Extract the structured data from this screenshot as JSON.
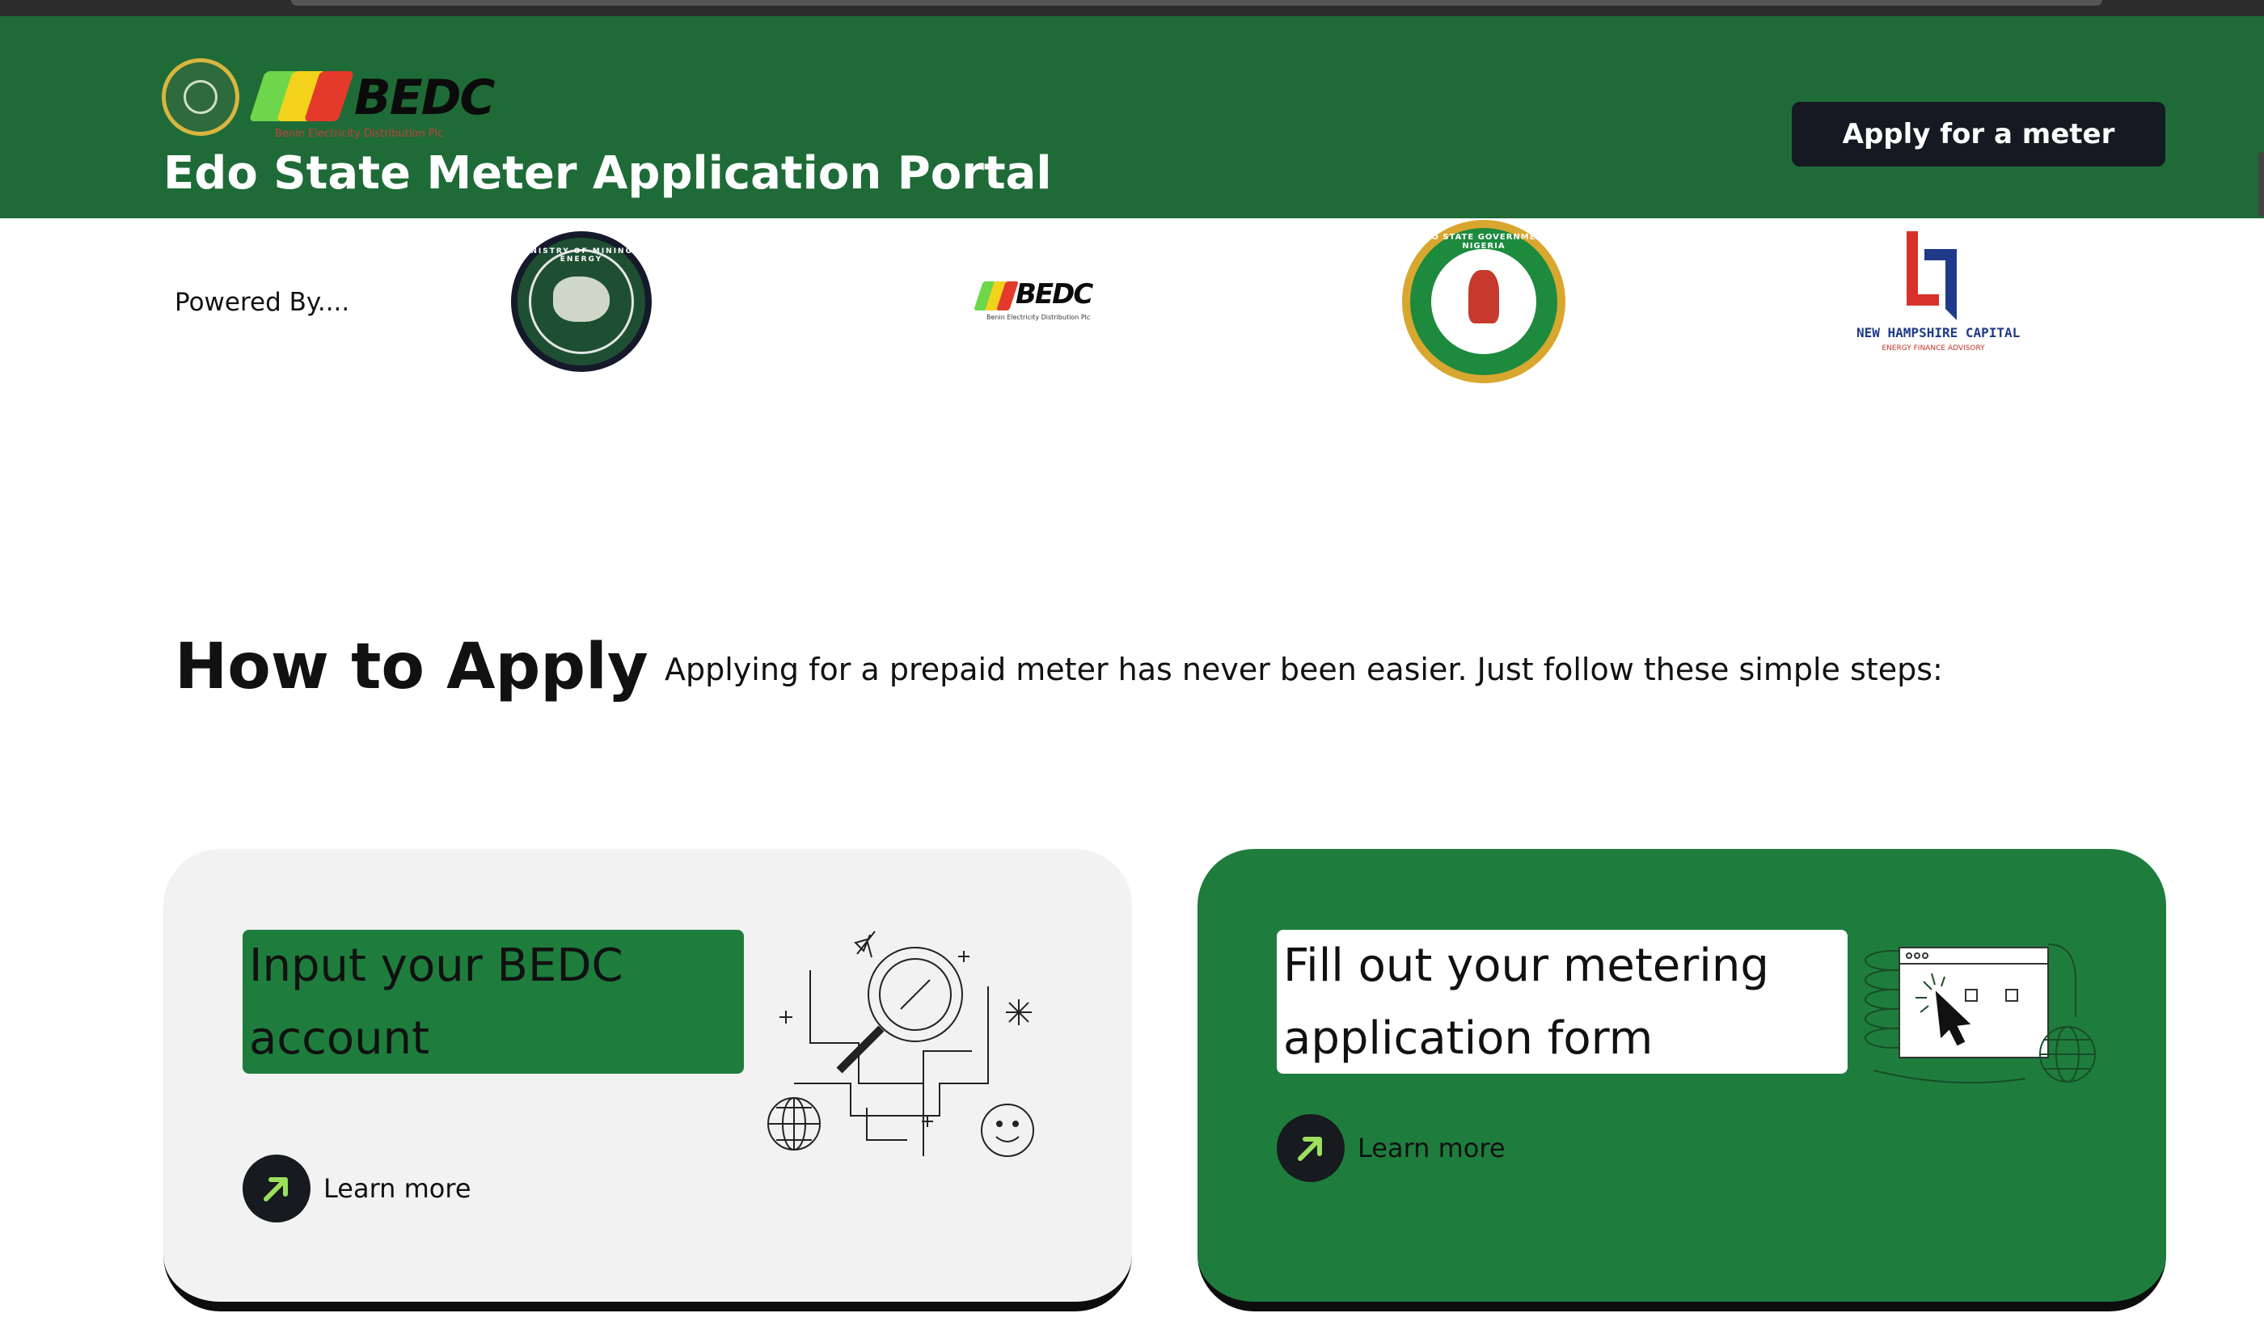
{
  "header": {
    "brand_logo_text": "BEDC",
    "brand_logo_subtext": "Benin Electricity Distribution Plc",
    "title": "Edo State Meter Application Portal",
    "apply_button": "Apply for a meter"
  },
  "partners": {
    "label": "Powered By....",
    "ministry_text": "MINISTRY OF MINING & ENERGY",
    "bedc_text": "BEDC",
    "bedc_subtext": "Benin Electricity Distribution Plc",
    "edo_text": "EDO STATE GOVERNMENT NIGERIA",
    "nhc_name": "NEW HAMPSHIRE CAPITAL",
    "nhc_tag": "ENERGY FINANCE ADVISORY"
  },
  "how_to_apply": {
    "title": "How to Apply",
    "description": "Applying for a prepaid meter has never been easier. Just follow these simple steps:"
  },
  "steps": [
    {
      "title": "Input your BEDC account",
      "link": "Learn more"
    },
    {
      "title": "Fill out your metering application form",
      "link": "Learn more"
    }
  ],
  "colors": {
    "header_green": "#1f6b38",
    "card_green": "#1e7d3d",
    "card_light": "#f2f2f2",
    "button_dark": "#151a22",
    "arrow_green": "#9be15d"
  },
  "icons": [
    "coat-of-arms-icon",
    "arrow-up-right-icon",
    "search-magnifier-illustration",
    "cursor-browser-illustration"
  ]
}
